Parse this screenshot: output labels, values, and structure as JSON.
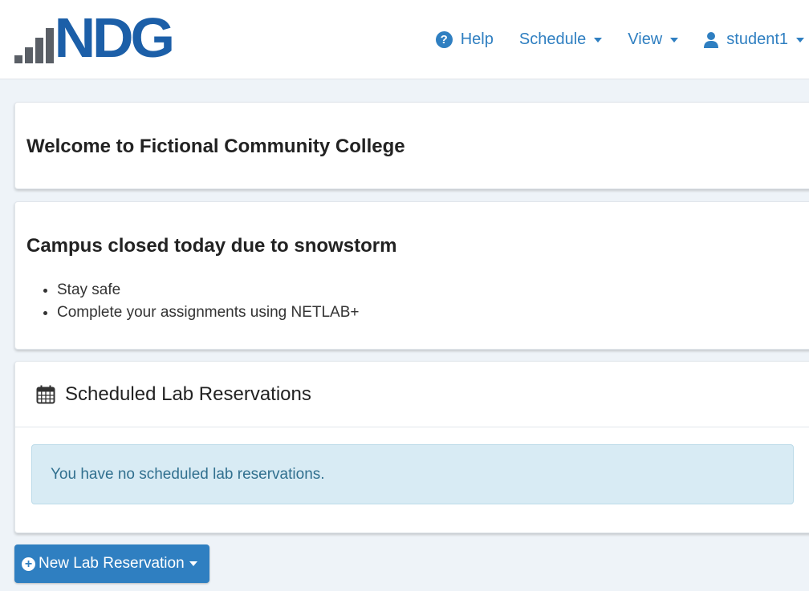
{
  "logo": {
    "text": "NDG"
  },
  "nav": {
    "help": "Help",
    "schedule": "Schedule",
    "view": "View",
    "user": "student1"
  },
  "welcome": {
    "title": "Welcome to Fictional Community College"
  },
  "announcement": {
    "title": "Campus closed today due to snowstorm",
    "items": [
      "Stay safe",
      "Complete your assignments using NETLAB+"
    ]
  },
  "reservations": {
    "title": "Scheduled Lab Reservations",
    "empty_message": "You have no scheduled lab reservations."
  },
  "actions": {
    "new_reservation": "New Lab Reservation"
  },
  "colors": {
    "accent": "#2f7fc1",
    "logo_blue": "#1c5fa8",
    "alert_bg": "#d8ebf4",
    "alert_text": "#31708f"
  },
  "icons": {
    "help": "question-circle-icon",
    "user": "user-icon",
    "calendar": "calendar-icon",
    "plus": "plus-circle-icon"
  }
}
